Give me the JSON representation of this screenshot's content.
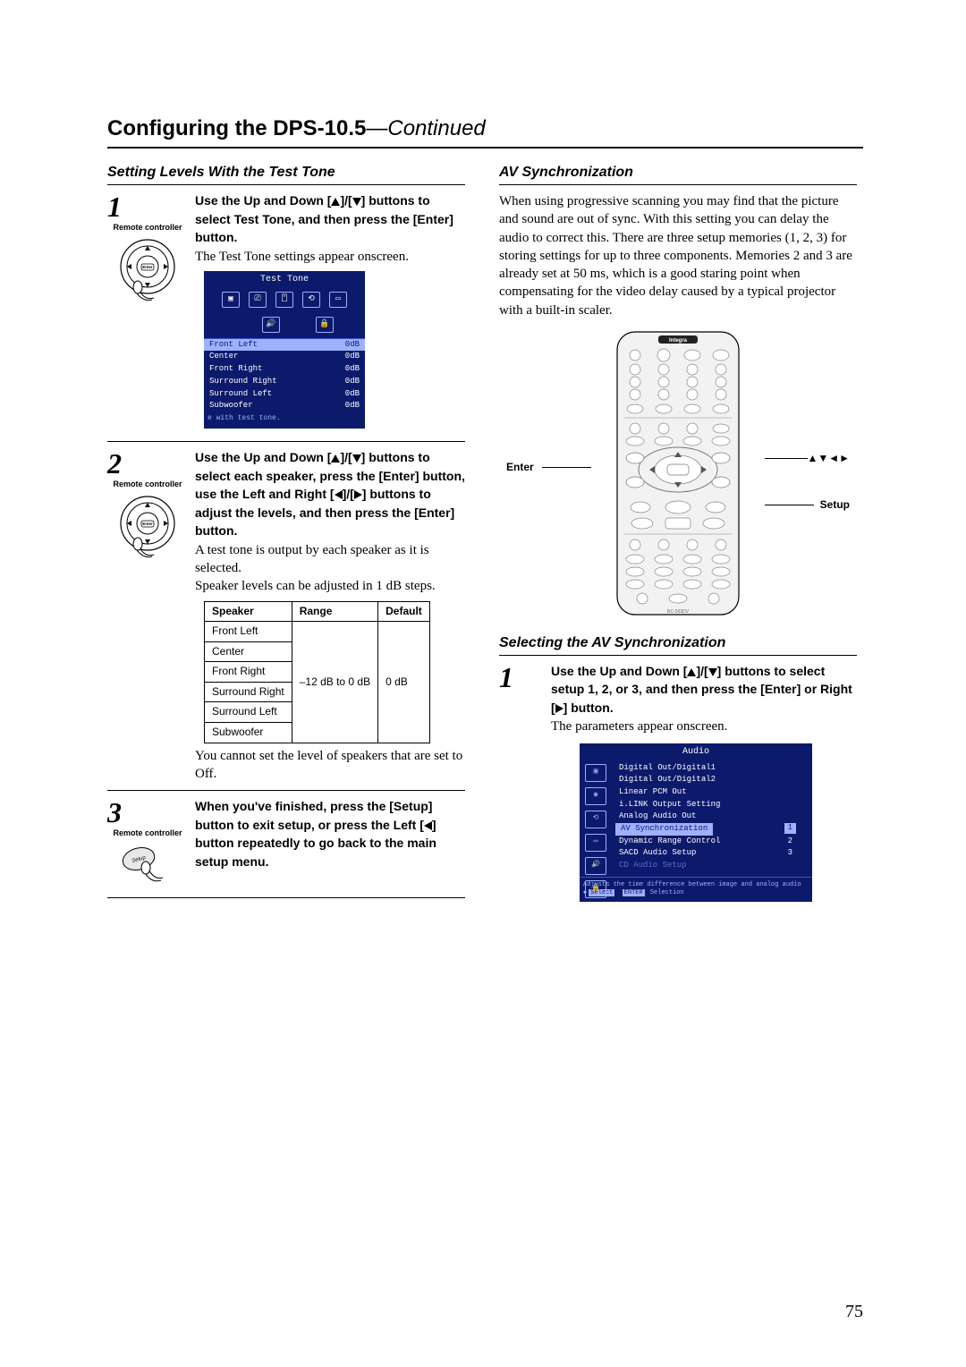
{
  "header": {
    "title_bold": "Configuring the DPS-10.5",
    "title_cont": "—Continued"
  },
  "left": {
    "heading": "Setting Levels With the Test Tone",
    "step1": {
      "num": "1",
      "rc": "Remote controller",
      "instr_prefix": "Use the Up and Down [",
      "instr_mid": "]/[",
      "instr_suffix1": "] buttons to select Test Tone, and then press the [Enter] button.",
      "body": "The Test Tone settings appear onscreen."
    },
    "osd1": {
      "title": "Test Tone",
      "rows": [
        {
          "label": "Front Left",
          "val": "0dB",
          "hl": true
        },
        {
          "label": "Center",
          "val": "0dB"
        },
        {
          "label": "Front Right",
          "val": "0dB"
        },
        {
          "label": "Surround Right",
          "val": "0dB"
        },
        {
          "label": "Surround Left",
          "val": "0dB"
        },
        {
          "label": "Subwoofer",
          "val": "0dB"
        }
      ],
      "foot": "e with test tone."
    },
    "step2": {
      "num": "2",
      "rc": "Remote controller",
      "instr_p1": "Use the Up and Down [",
      "instr_p2": "]/[",
      "instr_p3": "] buttons to select each speaker, press the [Enter] button, use the Left and Right [",
      "instr_p4": "]/[",
      "instr_p5": "] buttons to adjust the levels, and then press the [Enter] button.",
      "body1": "A test tone is output by each speaker as it is selected.",
      "body2": "Speaker levels can be adjusted in 1 dB steps.",
      "note": "You cannot set the level of speakers that are set to Off."
    },
    "table": {
      "h1": "Speaker",
      "h2": "Range",
      "h3": "Default",
      "rows": [
        "Front Left",
        "Center",
        "Front Right",
        "Surround Right",
        "Surround Left",
        "Subwoofer"
      ],
      "range": "–12 dB to 0 dB",
      "default": "0 dB"
    },
    "step3": {
      "num": "3",
      "rc": "Remote controller",
      "instr_p1": "When you've finished, press the [Setup] button to exit setup, or press the Left [",
      "instr_p2": "] button repeatedly to go back to the main setup menu."
    }
  },
  "right": {
    "heading1": "AV Synchronization",
    "para": "When using progressive scanning you may find that the picture and sound are out of sync. With this setting you can delay the audio to correct this. There are three setup memories (1, 2, 3) for storing settings for up to three components. Memories 2 and 3 are already set at 50 ms, which is a good staring point when compensating for the video delay caused by a typical projector with a built-in scaler.",
    "rlabels": {
      "enter": "Enter",
      "setup": "Setup",
      "arrows": "▲▼◄►"
    },
    "rc_model": "RC-563DV",
    "brand": "Integra",
    "heading2": "Selecting the AV Synchronization",
    "step1": {
      "num": "1",
      "instr_p1": "Use the Up and Down [",
      "instr_p2": "]/[",
      "instr_p3": "] buttons to select setup 1, 2, or 3, and then press the [Enter] or Right [",
      "instr_p4": "] button.",
      "body": "The parameters appear onscreen."
    },
    "osd2": {
      "title": "Audio",
      "items": [
        "Digital Out/Digital1",
        "Digital Out/Digital2",
        "Linear PCM Out",
        "i.LINK Output Setting",
        "Analog Audio Out"
      ],
      "hl_item": "AV Synchronization",
      "items2": [
        "Dynamic Range Control",
        "SACD Audio Setup"
      ],
      "dim_item": "CD Audio Setup",
      "nums": [
        "1",
        "2",
        "3"
      ],
      "foot_line1": "Adjusts the time difference between image and analog audio",
      "foot_sel": "Select",
      "foot_enter": "ENTER",
      "foot_selection": "Selection"
    }
  },
  "pagenum": "75"
}
